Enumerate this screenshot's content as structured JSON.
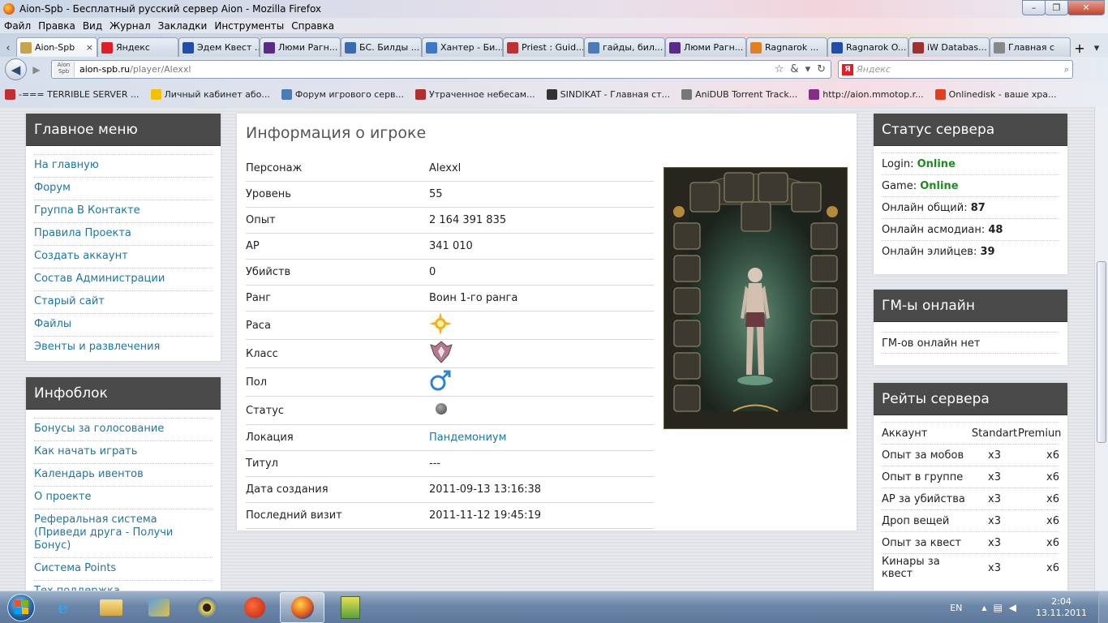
{
  "window": {
    "title": "Aion-Spb - Бесплатный русский сервер Aion - Mozilla Firefox",
    "minimize": "–",
    "maximize": "❐",
    "close": "✕"
  },
  "menu": [
    "Файл",
    "Правка",
    "Вид",
    "Журнал",
    "Закладки",
    "Инструменты",
    "Справка"
  ],
  "tabs": [
    {
      "label": "Aion-Spb",
      "icon_color": "#c8a34a",
      "active": true
    },
    {
      "label": "Яндекс",
      "icon_color": "#e31d24"
    },
    {
      "label": "Эдем Квест ...",
      "icon_color": "#1f4fa8"
    },
    {
      "label": "Люми Рагн...",
      "icon_color": "#5a2a8a"
    },
    {
      "label": "БС. Билды ...",
      "icon_color": "#3a6ab0"
    },
    {
      "label": "Хантер - Би...",
      "icon_color": "#3c78c8"
    },
    {
      "label": "Priest : Guid...",
      "icon_color": "#c03030"
    },
    {
      "label": "гайды, бил...",
      "icon_color": "#4a7ab8"
    },
    {
      "label": "Люми Рагн...",
      "icon_color": "#5a2a8a"
    },
    {
      "label": "Ragnarok ...",
      "icon_color": "#e08020"
    },
    {
      "label": "Ragnarok O...",
      "icon_color": "#1f4fa8"
    },
    {
      "label": "iW Databas...",
      "icon_color": "#a03030"
    },
    {
      "label": "Главная с",
      "icon_color": "#888888"
    }
  ],
  "nav": {
    "url_host": "aion-spb.ru",
    "url_path": "/player/Alexxl",
    "site_badge": "Aion Spb",
    "search_placeholder": "Яндекс",
    "search_engine": "Я"
  },
  "bookmarks": [
    {
      "label": "-=== TERRIBLE SERVER ...",
      "color": "#c03030"
    },
    {
      "label": "Личный кабинет або...",
      "color": "#f2c200"
    },
    {
      "label": "Форум игрового серв...",
      "color": "#4a7ab8"
    },
    {
      "label": "Утраченное небесам...",
      "color": "#b03030"
    },
    {
      "label": "SINDIKAT - Главная ст...",
      "color": "#333333"
    },
    {
      "label": "AniDUB Torrent Track...",
      "color": "#777777"
    },
    {
      "label": "http://aion.mmotop.r...",
      "color": "#8a2a8a"
    },
    {
      "label": "Onlinedisk - ваше хра...",
      "color": "#e04020"
    }
  ],
  "main_menu": {
    "title": "Главное меню",
    "items": [
      "На главную",
      "Форум",
      "Группа В Контакте",
      "Правила Проекта",
      "Создать аккаунт",
      "Состав Администрации",
      "Старый сайт",
      "Файлы",
      "Эвенты и развлечения"
    ]
  },
  "info_block": {
    "title": "Инфоблок",
    "items": [
      "Бонусы за голосование",
      "Как начать играть",
      "Календарь ивентов",
      "О проекте",
      "Реферальная система (Приведи друга - Получи Бонус)",
      "Система Points",
      "Тех.поддержка"
    ]
  },
  "player": {
    "title": "Информация о игроке",
    "rows": [
      {
        "k": "Персонаж",
        "v": "Alexxl"
      },
      {
        "k": "Уровень",
        "v": "55"
      },
      {
        "k": "Опыт",
        "v": "2 164 391 835"
      },
      {
        "k": "AP",
        "v": "341 010"
      },
      {
        "k": "Убийств",
        "v": "0"
      },
      {
        "k": "Ранг",
        "v": "Воин 1-го ранга"
      },
      {
        "k": "Раса",
        "v": "",
        "icon": "race-elyos-icon"
      },
      {
        "k": "Класс",
        "v": "",
        "icon": "class-emblem-icon"
      },
      {
        "k": "Пол",
        "v": "",
        "icon": "male-gender-icon"
      },
      {
        "k": "Статус",
        "v": "",
        "icon": "status-offline-icon"
      },
      {
        "k": "Локация",
        "v": "Пандемониум",
        "link": true
      },
      {
        "k": "Титул",
        "v": "---"
      },
      {
        "k": "Дата создания",
        "v": "2011-09-13 13:16:38"
      },
      {
        "k": "Последний визит",
        "v": "2011-11-12 19:45:19"
      }
    ]
  },
  "server_status": {
    "title": "Статус сервера",
    "login_label": "Login:",
    "login_value": "Online",
    "game_label": "Game:",
    "game_value": "Online",
    "total_label": "Онлайн общий:",
    "total_value": "87",
    "asmo_label": "Онлайн асмодиан:",
    "asmo_value": "48",
    "ely_label": "Онлайн элийцев:",
    "ely_value": "39"
  },
  "gm_online": {
    "title": "ГМ-ы онлайн",
    "text": "ГМ-ов онлайн нет"
  },
  "rates": {
    "title": "Рейты сервера",
    "header": [
      "Аккаунт",
      "Standart",
      "Premiun"
    ],
    "rows": [
      [
        "Опыт за мобов",
        "x3",
        "x6"
      ],
      [
        "Опыт в группе",
        "x3",
        "x6"
      ],
      [
        "AP за убийства",
        "x3",
        "x6"
      ],
      [
        "Дроп вещей",
        "x3",
        "x6"
      ],
      [
        "Опыт за квест",
        "x3",
        "x6"
      ],
      [
        "Кинары за квест",
        "x3",
        "x6"
      ]
    ]
  },
  "taskbar": {
    "lang": "EN",
    "time": "2:04",
    "date": "13.11.2011"
  }
}
